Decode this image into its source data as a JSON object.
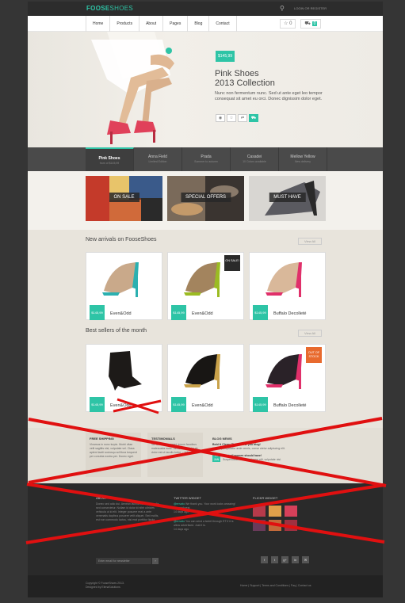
{
  "brand": {
    "logo_main": "FOOSE",
    "logo_sub": "SHOES"
  },
  "topbar": {
    "search_icon": "search-icon",
    "login": "LOGIN OR REGISTER"
  },
  "nav": {
    "items": [
      "Home",
      "Products",
      "About",
      "Pages",
      "Blog",
      "Contact"
    ],
    "wishlist_icon": "star-icon",
    "wishlist_count": "0",
    "cart_icon": "cart-icon",
    "cart_count": "0"
  },
  "hero": {
    "price": "$145,99",
    "title_line1": "Pink Shoes",
    "title_line2": "2013 Collection",
    "text": "Nunc non fermentum nunc. Sed ut ante eget leo tempor consequat sit amet eu orci. Donec dignissim dolor eget.",
    "icons": [
      "eye-icon",
      "star-icon",
      "compare-icon",
      "cart-icon"
    ]
  },
  "slider_tabs": [
    {
      "title": "Pink Shoes",
      "sub": "from of $145,99"
    },
    {
      "title": "Anna Field",
      "sub": "Limited Edition"
    },
    {
      "title": "Prada",
      "sub": "Summer to autumn"
    },
    {
      "title": "Casadei",
      "sub": "10 Colors available"
    },
    {
      "title": "Mellow Yellow",
      "sub": "New delivery"
    }
  ],
  "promos": [
    "ON SALE",
    "SPECIAL OFFERS",
    "MUST HAVE"
  ],
  "new_arrivals": {
    "title": "New arrivals on FooseShoes",
    "view_all": "View All",
    "items": [
      {
        "price": "$145,99",
        "name": "Even&Odd",
        "badge": "",
        "shoe_color": "#c9a98a",
        "accent": "#2bb0b0"
      },
      {
        "price": "$145,99",
        "name": "Even&Odd",
        "badge": "ON SALE!",
        "shoe_color": "#a3845e",
        "accent": "#9bbb22"
      },
      {
        "price": "$145,99",
        "name": "Buffalo Decolleté",
        "badge": "",
        "shoe_color": "#d9b89a",
        "accent": "#e0306a"
      }
    ]
  },
  "best_sellers": {
    "title": "Best sellers of the month",
    "view_all": "View All",
    "items": [
      {
        "price": "$145,99",
        "name": "Even&Odd",
        "badge": "",
        "shoe_color": "#1d1a18",
        "accent": "#333"
      },
      {
        "price": "$145,99",
        "name": "Even&Odd",
        "badge": "",
        "shoe_color": "#181614",
        "accent": "#c9a24a"
      },
      {
        "price": "$145,99",
        "name": "Buffalo Decolleté",
        "badge": "OUT OF STOCK",
        "shoe_color": "#2a2228",
        "accent": "#e0306a"
      }
    ]
  },
  "info": {
    "shipping": {
      "title": "FREE SHIPPING",
      "text": "Vivamus in nunc turpis. Morbi vitae velit sagittis nisl, vulputate vel. Class aptent taciti sociosqu ad litora torquent per conubia nostra per. Donec eget."
    },
    "testimonials": {
      "title": "TESTIMONIALS",
      "text": "Vel lorem vitae amet, ipsum faucibus malesuada nunc. Vel amet et dolor sit, dolor est ut iaculis tortor. - John Doe -"
    },
    "blog": {
      "title": "BLOG NEWS",
      "post1_title": "Bold & Clean: The best for you blog!",
      "post1_text": "Sed ut perspiciatis unde omnis, conse ctetur adipiscing elit.",
      "post2_day": "26",
      "post2_month": "JAN",
      "post2_title": "What all women should have!",
      "post2_text": "Suspendisse in nisi vel lorem elit, vulputate nisi."
    }
  },
  "footer": {
    "about_title": "ABOUT",
    "about_text": "Donec sed odio dui. Aenean lacinia bibendum nulla sed consectetur. Nullam id dolor id nibh ultricies vehicula ut id elit. Integer posuere erat a ante venenatis dapibus posuere velit aliquet. Sed mollis, est non commodo luctus, nisi erat porttitor ligula.",
    "twitter_title": "TWITTER WIDGET",
    "tweet1_user": "@envato",
    "tweet1_text": "We thank you. Your work looks amazing! #themeforest",
    "tweet1_time": "14 days ago",
    "tweet2_user": "@envato",
    "tweet2_text": "You can send a tweet through ET if it is allow advertised. Just it is.",
    "tweet2_time": "14 days ago",
    "flickr_title": "FLICKR WIDGET",
    "newsletter_placeholder": "Enter email for newsletter",
    "newsletter_btn": "›",
    "social": [
      "f",
      "t",
      "g+",
      "in",
      "✉"
    ]
  },
  "bottom": {
    "copy1": "Copyright © FooseShoes 2013.",
    "copy2": "Designed by ElenaSolutions",
    "links": "Home | Support | Terms and Conditions | Faq | Contact us"
  },
  "colors": {
    "accent": "#2ec4a6",
    "dark": "#2a2a2a",
    "cross": "#e01010"
  }
}
